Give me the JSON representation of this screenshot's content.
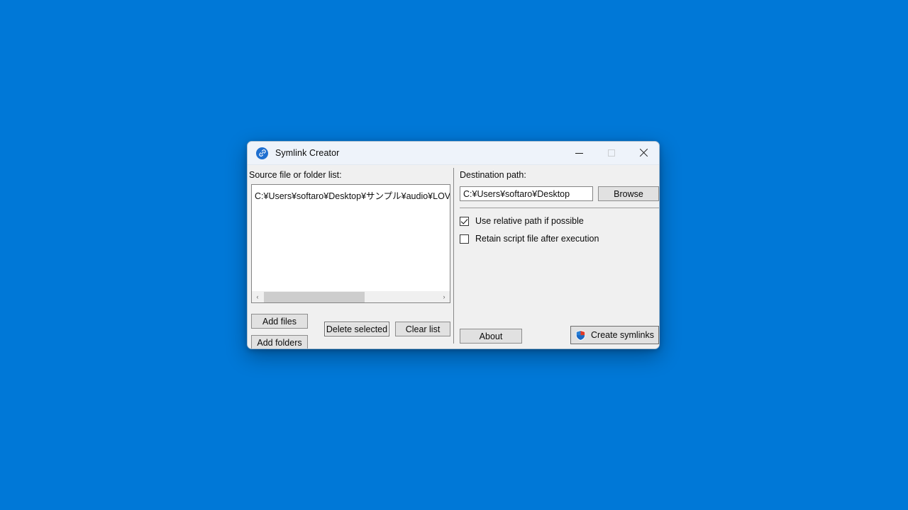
{
  "desktop": {
    "background_color": "#0078d7"
  },
  "window": {
    "title": "Symlink Creator",
    "icon": "link-icon",
    "controls": {
      "minimize": "minimize-icon",
      "maximize": "maximize-icon",
      "close": "close-icon"
    }
  },
  "left_panel": {
    "label": "Source file or folder list:",
    "list_items": [
      "C:¥Users¥softaro¥Desktop¥サンプル¥audio¥LOVE PS"
    ],
    "scrollbar": {
      "left_arrow": "‹",
      "right_arrow": "›"
    },
    "buttons": {
      "add_files": "Add files",
      "add_folders": "Add folders",
      "delete_selected": "Delete selected",
      "clear_list": "Clear list"
    }
  },
  "right_panel": {
    "label": "Destination path:",
    "destination_value": "C:¥Users¥softaro¥Desktop",
    "destination_placeholder": "",
    "browse_button": "Browse",
    "options": [
      {
        "label": "Use relative path if possible",
        "checked": true
      },
      {
        "label": "Retain script file after execution",
        "checked": false
      }
    ],
    "about_button": "About",
    "create_button": "Create symlinks",
    "create_button_icon": "uac-shield-icon"
  },
  "colors": {
    "accent": "#0078d7",
    "titlebar_background": "#eef3fa",
    "dialog_background": "#f0f0f0",
    "button_face": "#e1e1e1",
    "field_background": "#ffffff"
  }
}
